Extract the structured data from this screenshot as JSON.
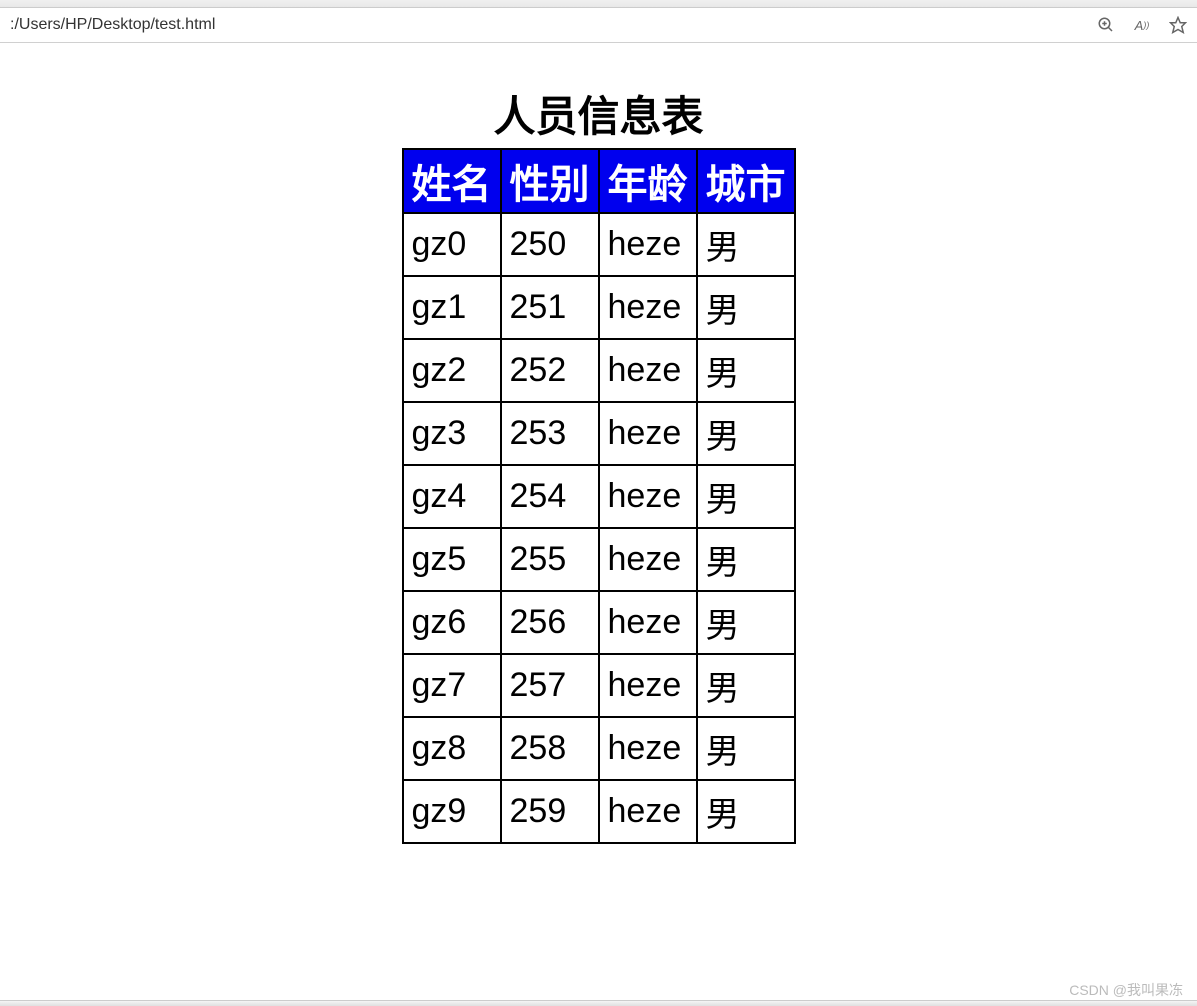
{
  "browser": {
    "url": ":/Users/HP/Desktop/test.html",
    "icons": {
      "zoom": "zoom",
      "read_aloud": "A))",
      "favorite": "star"
    }
  },
  "page": {
    "title": "人员信息表"
  },
  "table": {
    "headers": [
      "姓名",
      "性别",
      "年龄",
      "城市"
    ],
    "rows": [
      [
        "gz0",
        "250",
        "heze",
        "男"
      ],
      [
        "gz1",
        "251",
        "heze",
        "男"
      ],
      [
        "gz2",
        "252",
        "heze",
        "男"
      ],
      [
        "gz3",
        "253",
        "heze",
        "男"
      ],
      [
        "gz4",
        "254",
        "heze",
        "男"
      ],
      [
        "gz5",
        "255",
        "heze",
        "男"
      ],
      [
        "gz6",
        "256",
        "heze",
        "男"
      ],
      [
        "gz7",
        "257",
        "heze",
        "男"
      ],
      [
        "gz8",
        "258",
        "heze",
        "男"
      ],
      [
        "gz9",
        "259",
        "heze",
        "男"
      ]
    ]
  },
  "watermark": "CSDN @我叫果冻"
}
